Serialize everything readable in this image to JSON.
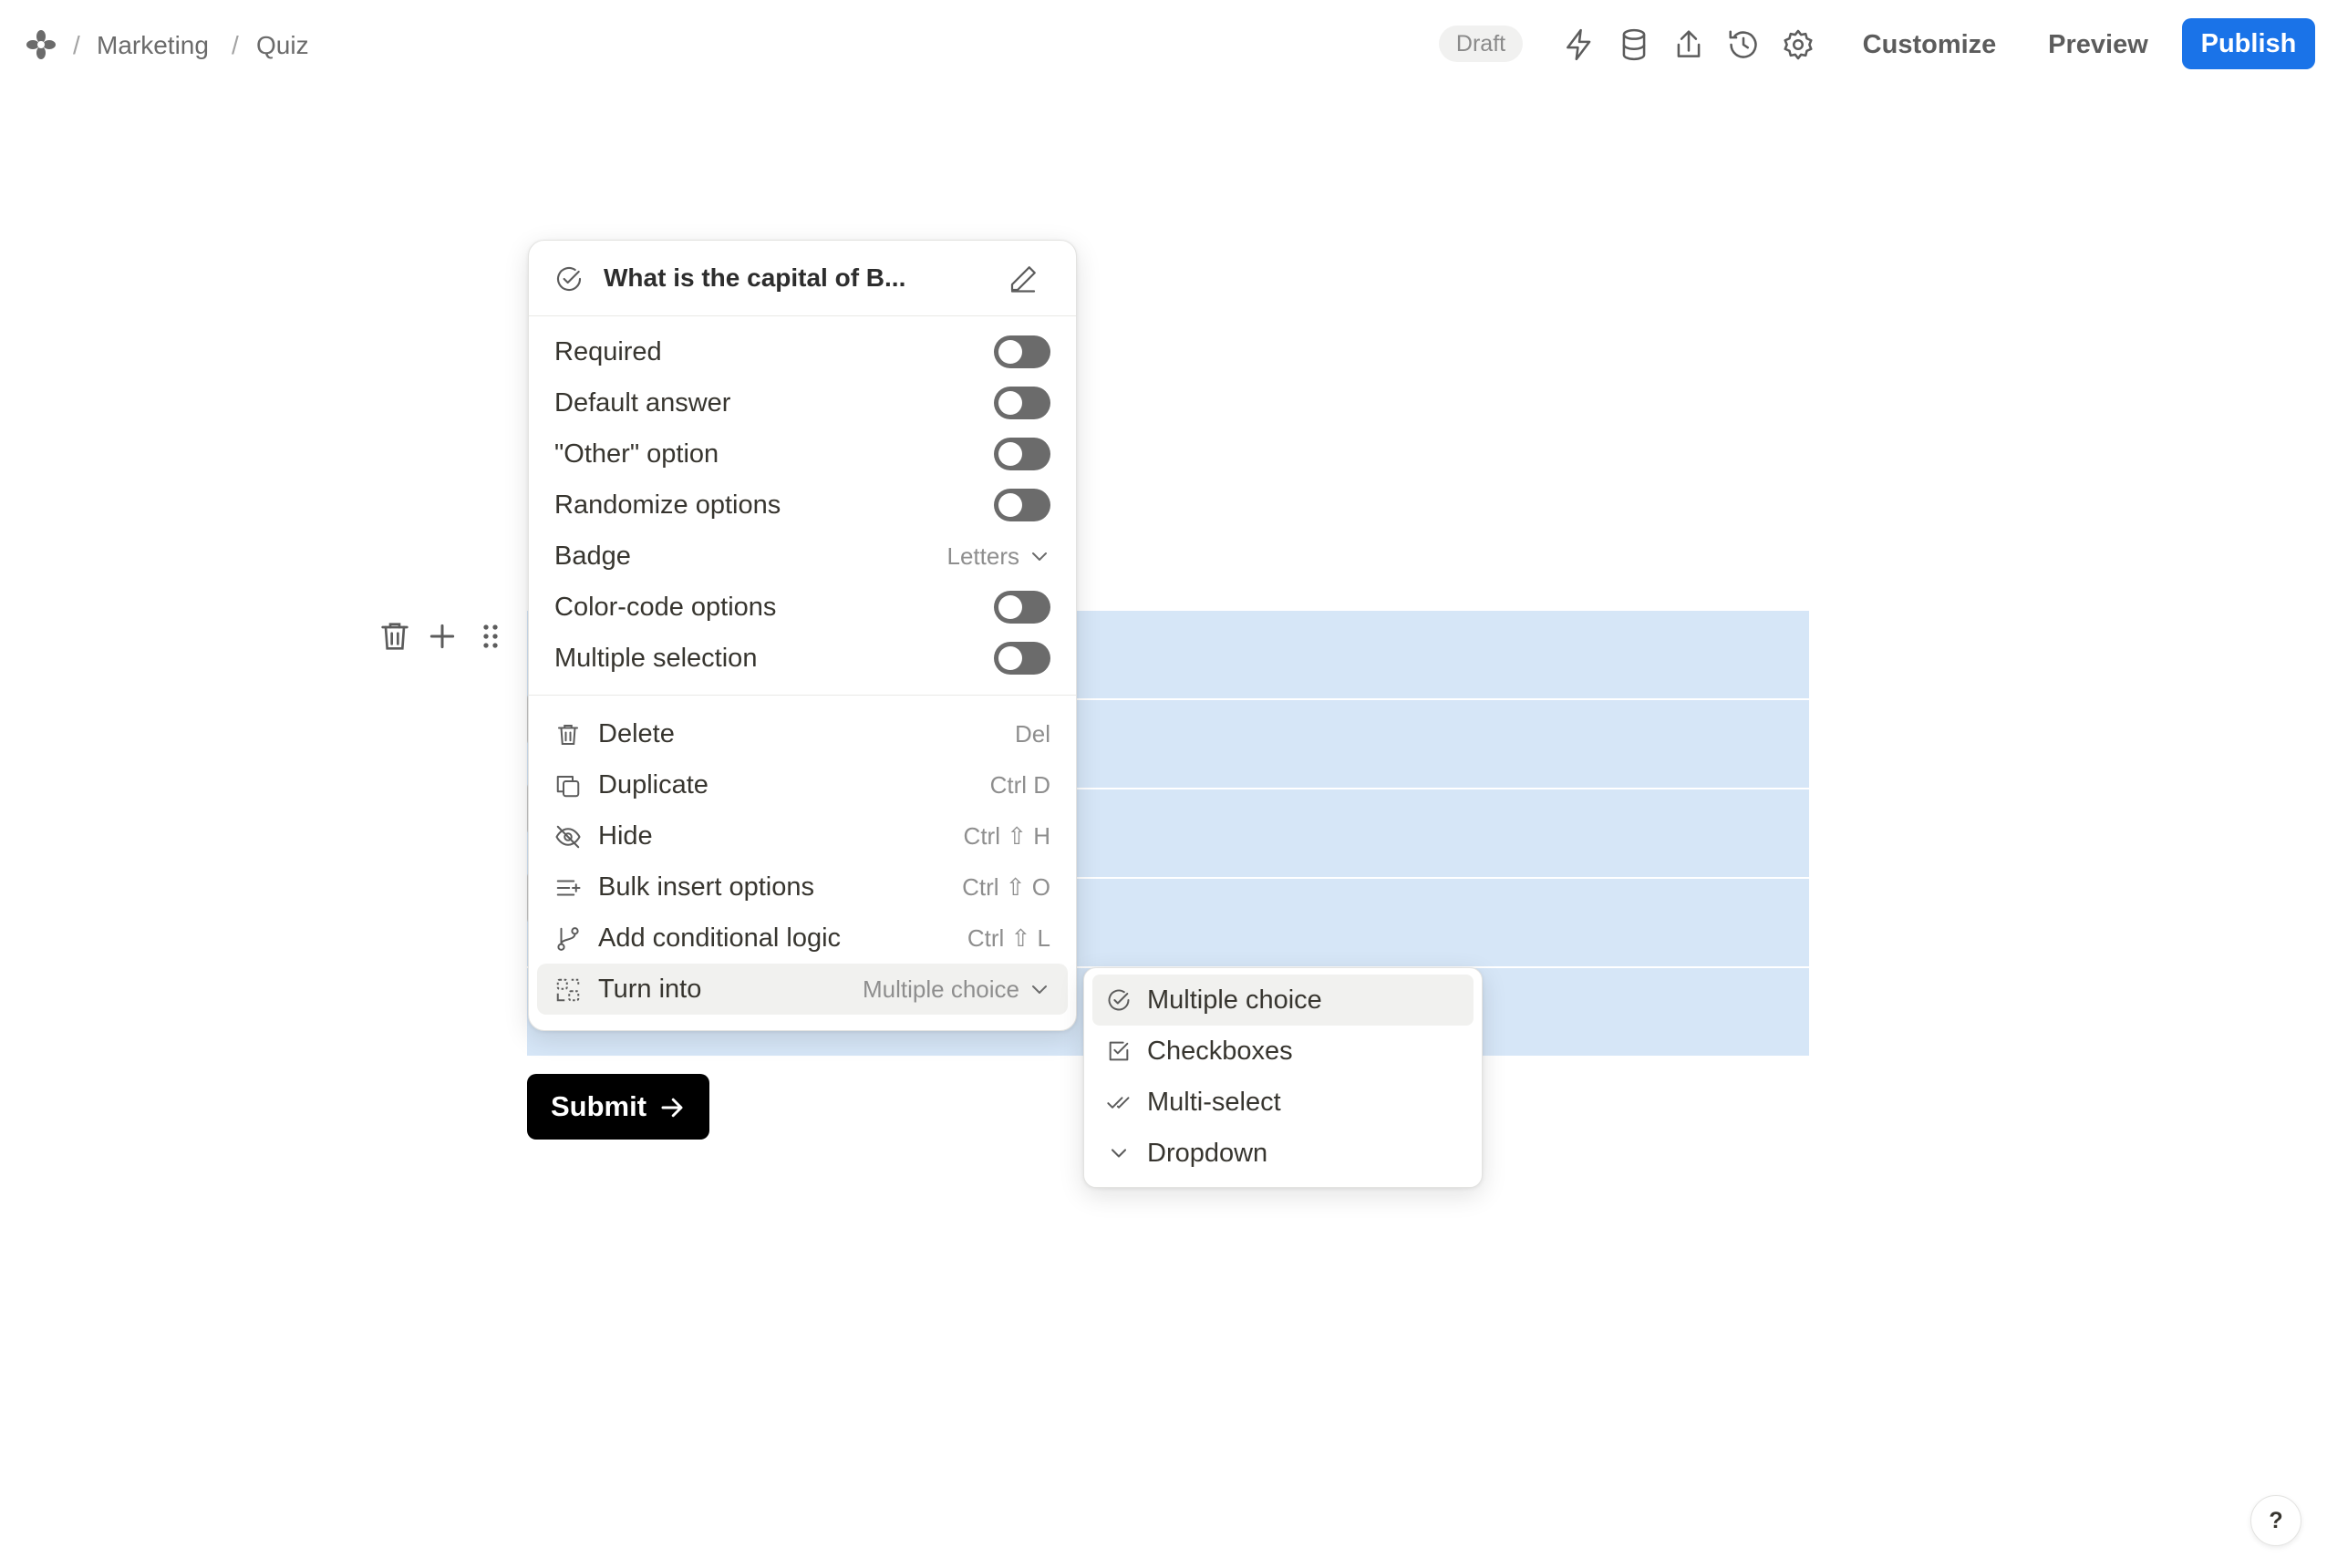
{
  "breadcrumb": {
    "workspace": "Marketing",
    "page": "Quiz",
    "separator": "/"
  },
  "header": {
    "status": "Draft",
    "customize_label": "Customize",
    "preview_label": "Preview",
    "publish_label": "Publish",
    "icons": [
      "lightning-icon",
      "database-icon",
      "share-icon",
      "history-icon",
      "settings-icon"
    ]
  },
  "question_menu": {
    "title": "What is the capital of B...",
    "settings": [
      {
        "label": "Required",
        "type": "toggle",
        "on": false
      },
      {
        "label": "Default answer",
        "type": "toggle",
        "on": false
      },
      {
        "label": "\"Other\" option",
        "type": "toggle",
        "on": false
      },
      {
        "label": "Randomize options",
        "type": "toggle",
        "on": false
      },
      {
        "label": "Badge",
        "type": "select",
        "value": "Letters"
      },
      {
        "label": "Color-code options",
        "type": "toggle",
        "on": false
      },
      {
        "label": "Multiple selection",
        "type": "toggle",
        "on": false
      }
    ],
    "actions": [
      {
        "label": "Delete",
        "shortcut": "Del",
        "icon": "trash-icon"
      },
      {
        "label": "Duplicate",
        "shortcut": "Ctrl D",
        "icon": "duplicate-icon"
      },
      {
        "label": "Hide",
        "shortcut": "Ctrl ⇧ H",
        "icon": "eye-off-icon"
      },
      {
        "label": "Bulk insert options",
        "shortcut": "Ctrl ⇧ O",
        "icon": "bulk-insert-icon"
      },
      {
        "label": "Add conditional logic",
        "shortcut": "Ctrl ⇧ L",
        "icon": "branch-icon"
      },
      {
        "label": "Turn into",
        "value": "Multiple choice",
        "icon": "turn-into-icon"
      }
    ]
  },
  "turn_into_menu": {
    "items": [
      {
        "label": "Multiple choice",
        "icon": "circle-check-icon",
        "selected": true
      },
      {
        "label": "Checkboxes",
        "icon": "checkbox-icon",
        "selected": false
      },
      {
        "label": "Multi-select",
        "icon": "double-check-icon",
        "selected": false
      },
      {
        "label": "Dropdown",
        "icon": "chevron-down-icon",
        "selected": false
      }
    ]
  },
  "submit_label": "Submit",
  "help_label": "?",
  "colors": {
    "accent": "#1a73e8",
    "selection": "#d6e6f7",
    "toggle_off": "#6b6b6b"
  }
}
